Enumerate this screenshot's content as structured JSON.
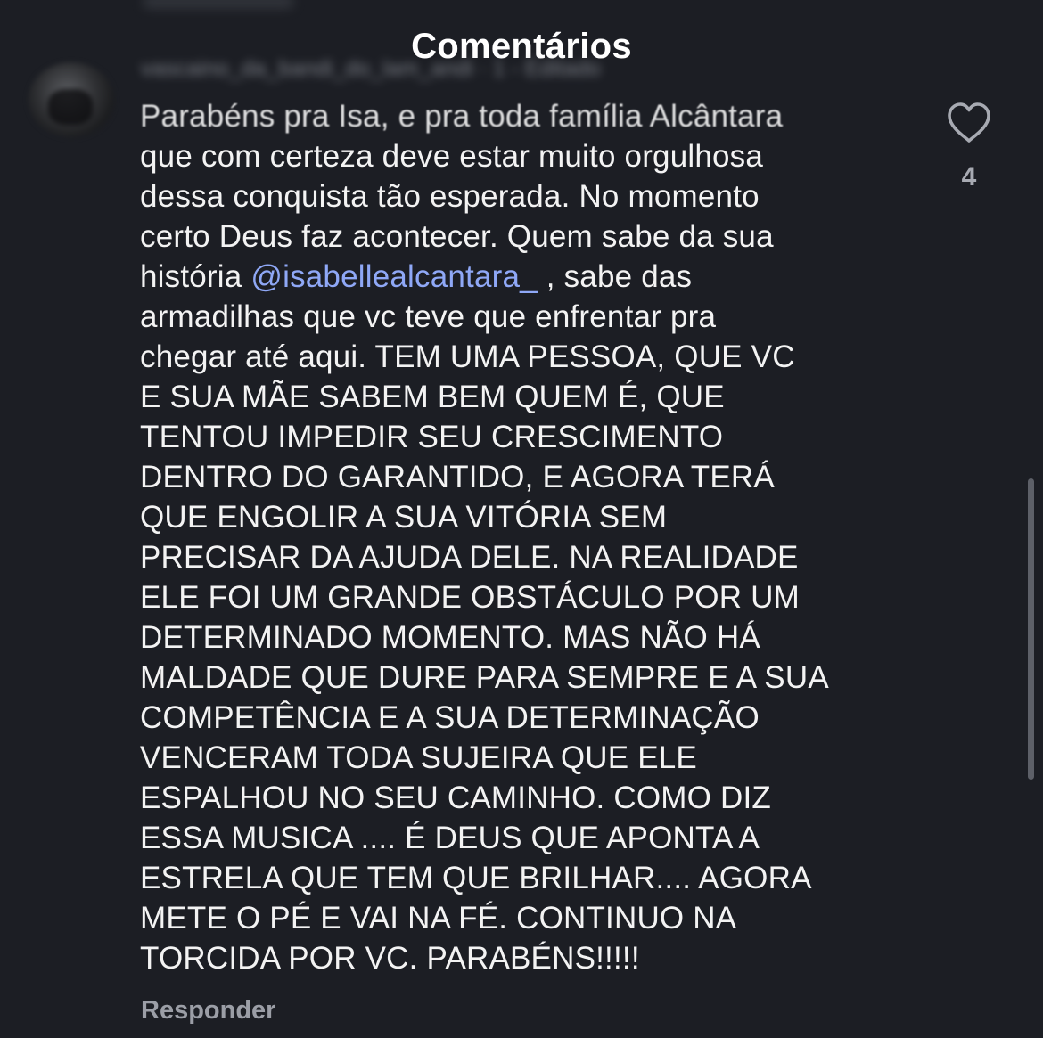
{
  "header": {
    "title": "Comentários"
  },
  "comment": {
    "username": "vascaino_da_bandi_do_lam_andi · 1 - Editado",
    "text_first_line": "Parabéns pra Isa, e pra toda família Alcântara",
    "text_part1": "que com certeza deve estar muito orgulhosa\ndessa conquista tão esperada. No momento\ncerto Deus faz acontecer. Quem sabe da sua\nhistória ",
    "mention": "@isabellealcantara_",
    "text_part2": " , sabe das\narmadilhas que vc teve que enfrentar pra\nchegar até aqui. TEM UMA PESSOA, QUE VC\nE SUA MÃE SABEM BEM QUEM É, QUE\nTENTOU IMPEDIR SEU CRESCIMENTO\nDENTRO DO GARANTIDO, E AGORA TERÁ\nQUE  ENGOLIR A SUA VITÓRIA SEM\nPRECISAR DA AJUDA DELE. NA REALIDADE\nELE FOI UM GRANDE OBSTÁCULO POR UM\nDETERMINADO MOMENTO. MAS NÃO HÁ\nMALDADE QUE DURE PARA SEMPRE E A SUA\nCOMPETÊNCIA E A SUA DETERMINAÇÃO\nVENCERAM TODA SUJEIRA QUE ELE\nESPALHOU NO SEU CAMINHO. COMO DIZ\nESSA MUSICA .... É DEUS QUE APONTA A\nESTRELA QUE TEM QUE BRILHAR.... AGORA\nMETE O PÉ E VAI NA FÉ. CONTINUO NA\nTORCIDA POR VC. PARABÉNS!!!!!",
    "reply_label": "Responder",
    "like_count": "4",
    "like_icon": "heart-outline-icon"
  },
  "colors": {
    "background": "#1c1e24",
    "text": "#f3f3f3",
    "mention": "#8fa8f6",
    "muted": "#9b9ea6"
  }
}
